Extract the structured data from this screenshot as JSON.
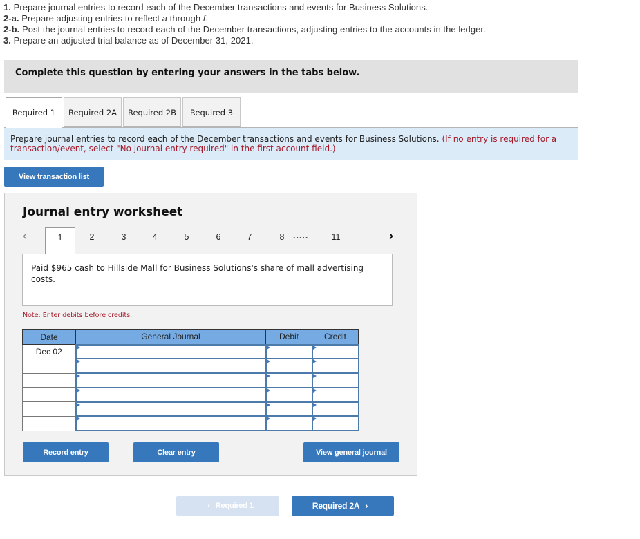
{
  "instructions": [
    {
      "num": "1.",
      "text": " Prepare journal entries to record each of the December transactions and events for Business Solutions."
    },
    {
      "num": "2-a.",
      "text_before": " Prepare adjusting entries to reflect ",
      "italic1": "a",
      "text_mid": " through ",
      "italic2": "f",
      "text_after": "."
    },
    {
      "num": "2-b.",
      "text": " Post the journal entries to record each of the December transactions, adjusting entries to the accounts in the ledger."
    },
    {
      "num": "3.",
      "text": " Prepare an adjusted trial balance as of December 31, 2021."
    }
  ],
  "banner": "Complete this question by entering your answers in the tabs below.",
  "tabs": [
    {
      "label": "Required 1",
      "active": true
    },
    {
      "label": "Required 2A",
      "active": false
    },
    {
      "label": "Required 2B",
      "active": false
    },
    {
      "label": "Required 3",
      "active": false
    }
  ],
  "info": {
    "text": "Prepare journal entries to record each of the December transactions and events for Business Solutions. ",
    "red": "(If no entry is required for a transaction/event, select \"No journal entry required\" in the first account field.)"
  },
  "view_transaction_list": "View transaction list",
  "worksheet": {
    "title": "Journal entry worksheet",
    "pager": {
      "prev_icon": "‹",
      "next_icon": "›",
      "pages": [
        "1",
        "2",
        "3",
        "4",
        "5",
        "6",
        "7",
        "8"
      ],
      "ellipsis": ".....",
      "last": "11",
      "current": "1"
    },
    "description": "Paid $965 cash to Hillside Mall for Business Solutions's share of mall advertising costs.",
    "note": "Note: Enter debits before credits.",
    "table": {
      "headers": [
        "Date",
        "General Journal",
        "Debit",
        "Credit"
      ],
      "rows": [
        {
          "date": "Dec 02",
          "account": "",
          "debit": "",
          "credit": ""
        },
        {
          "date": "",
          "account": "",
          "debit": "",
          "credit": ""
        },
        {
          "date": "",
          "account": "",
          "debit": "",
          "credit": ""
        },
        {
          "date": "",
          "account": "",
          "debit": "",
          "credit": ""
        },
        {
          "date": "",
          "account": "",
          "debit": "",
          "credit": ""
        },
        {
          "date": "",
          "account": "",
          "debit": "",
          "credit": ""
        }
      ]
    },
    "buttons": {
      "record": "Record entry",
      "clear": "Clear entry",
      "view_general_journal": "View general journal"
    }
  },
  "nav": {
    "prev_label": "Required 1",
    "next_label": "Required 2A",
    "prev_icon": "‹",
    "next_icon": "›"
  },
  "colors": {
    "accent": "#3777bc",
    "header_blue": "#75aae3",
    "note_red": "#a31a2b",
    "info_bg": "#dcebf8"
  }
}
